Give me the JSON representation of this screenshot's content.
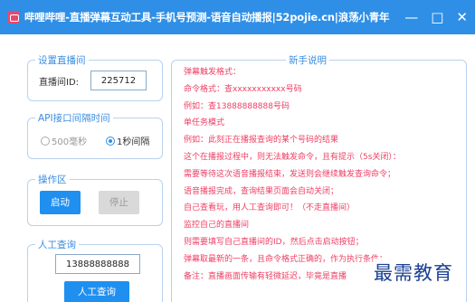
{
  "window": {
    "title": "哔哩哔哩-直播弹幕互动工具-手机号预测-语音自动播报|52pojie.cn|浪荡小青年",
    "minimize_glyph": "—",
    "maximize_glyph": "□",
    "close_glyph": "✕"
  },
  "live_room": {
    "group_title": "设置直播间",
    "label": "直播间ID:",
    "value": "225712"
  },
  "api_interval": {
    "group_title": "API接口间隔时间",
    "options": [
      {
        "label": "500毫秒",
        "checked": false
      },
      {
        "label": "1秒间隔",
        "checked": true
      }
    ]
  },
  "operation": {
    "group_title": "操作区",
    "start_label": "启动",
    "stop_label": "停止"
  },
  "manual_query": {
    "group_title": "人工查询",
    "phone_value": "13888888888",
    "query_label": "人工查询"
  },
  "help": {
    "group_title": "新手说明",
    "lines": [
      "弹幕触发格式：",
      "命令格式：查xxxxxxxxxxx号码",
      "例如：查13888888888号码",
      "单任务模式",
      "例如：此刻正在播报查询的某个号码的结果",
      "这个在播报过程中，则无法触发命令，且有提示（5s关闭）：",
      "需要等待这次语音播报结束，发送则会继续触发查询命令；",
      "语音播报完成，查询结果页面会自动关闭；",
      "自己查看玩，用人工查询即可！（不走直播间）",
      "监控自己的直播间",
      "则需要填写自己直播间的ID，然后点击启动按钮；",
      "弹幕取最新的一条，且命令格式正确的，作为执行条件；",
      "备注：直播画面传输有轻微延迟，毕竟是直播"
    ]
  },
  "watermark": "最需教育",
  "colors": {
    "titlebar": "#2f8fe6",
    "accent": "#1f8ff0",
    "help_text": "#ee4064",
    "group_border": "#b8d2ee"
  }
}
